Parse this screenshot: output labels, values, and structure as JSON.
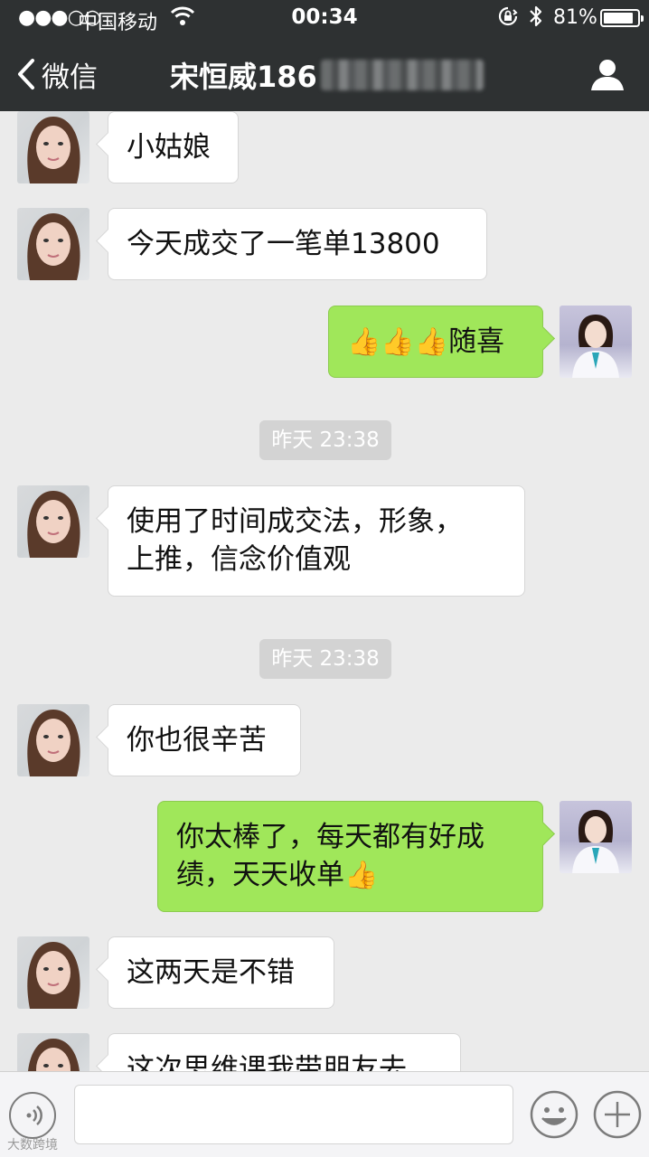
{
  "status_bar": {
    "signal": "●●●○○",
    "carrier": "中国移动",
    "time": "00:34",
    "battery_percent": "81%",
    "battery_level": 0.81
  },
  "nav": {
    "back_label": "微信",
    "title": "宋恒威186"
  },
  "messages": [
    {
      "side": "in",
      "text": "小姑娘"
    },
    {
      "side": "in",
      "text": "今天成交了一笔单13800"
    },
    {
      "side": "out",
      "text": "随喜",
      "emoji_prefix": "👍👍👍"
    },
    {
      "timestamp": "昨天 23:38"
    },
    {
      "side": "in",
      "line1": "使用了时间成交法，形象，",
      "line2": "上推，信念价值观"
    },
    {
      "timestamp": "昨天 23:38"
    },
    {
      "side": "in",
      "text": "你也很辛苦"
    },
    {
      "side": "out",
      "line1": "你太棒了，每天都有好成",
      "line2": "绩，天天收单",
      "emoji_suffix": "👍"
    },
    {
      "side": "in",
      "text": "这两天是不错"
    },
    {
      "side": "in",
      "text": "这次思维课我带朋友去"
    }
  ],
  "input": {
    "value": "",
    "placeholder": ""
  },
  "watermark": "大数跨境",
  "colors": {
    "header_bg": "#2e3132",
    "chat_bg": "#ebebeb",
    "outgoing_bubble": "#a0e75a",
    "incoming_bubble": "#ffffff",
    "timestamp_bg": "#d3d3d3"
  },
  "icons": {
    "back": "chevron-left-icon",
    "profile": "person-icon",
    "voice": "voice-icon",
    "emoji": "smiley-icon",
    "plus": "plus-icon"
  }
}
